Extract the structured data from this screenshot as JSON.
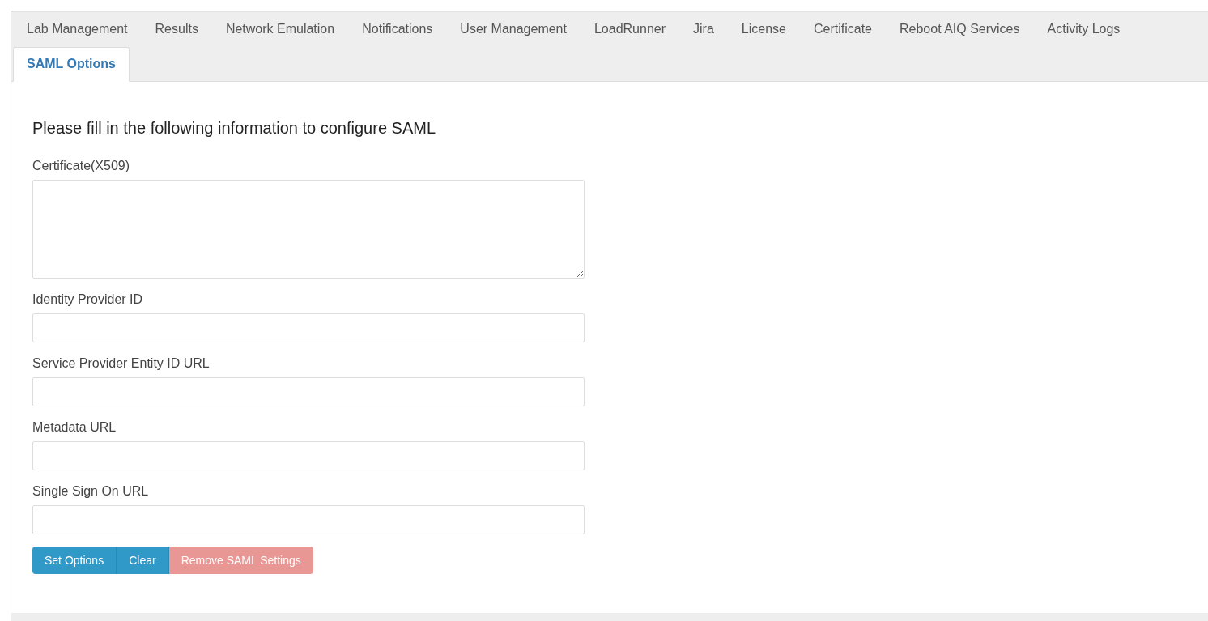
{
  "tabs": [
    {
      "label": "Lab Management",
      "selected": false
    },
    {
      "label": "Results",
      "selected": false
    },
    {
      "label": "Network Emulation",
      "selected": false
    },
    {
      "label": "Notifications",
      "selected": false
    },
    {
      "label": "User Management",
      "selected": false
    },
    {
      "label": "LoadRunner",
      "selected": false
    },
    {
      "label": "Jira",
      "selected": false
    },
    {
      "label": "License",
      "selected": false
    },
    {
      "label": "Certificate",
      "selected": false
    },
    {
      "label": "Reboot AIQ Services",
      "selected": false
    },
    {
      "label": "Activity Logs",
      "selected": false
    },
    {
      "label": "SAML Options",
      "selected": true
    }
  ],
  "form": {
    "heading": "Please fill in the following information to configure SAML",
    "fields": [
      {
        "kind": "textarea",
        "label": "Certificate(X509)"
      },
      {
        "kind": "input",
        "label": "Identity Provider ID"
      },
      {
        "kind": "input",
        "label": "Service Provider Entity ID URL"
      },
      {
        "kind": "input",
        "label": "Metadata URL"
      },
      {
        "kind": "input",
        "label": "Single Sign On URL"
      }
    ],
    "buttons": [
      {
        "kind": "primary",
        "label": "Set Options",
        "disabled": false
      },
      {
        "kind": "primary",
        "label": "Clear",
        "disabled": false
      },
      {
        "kind": "danger",
        "label": "Remove SAML Settings",
        "disabled": true
      }
    ]
  }
}
